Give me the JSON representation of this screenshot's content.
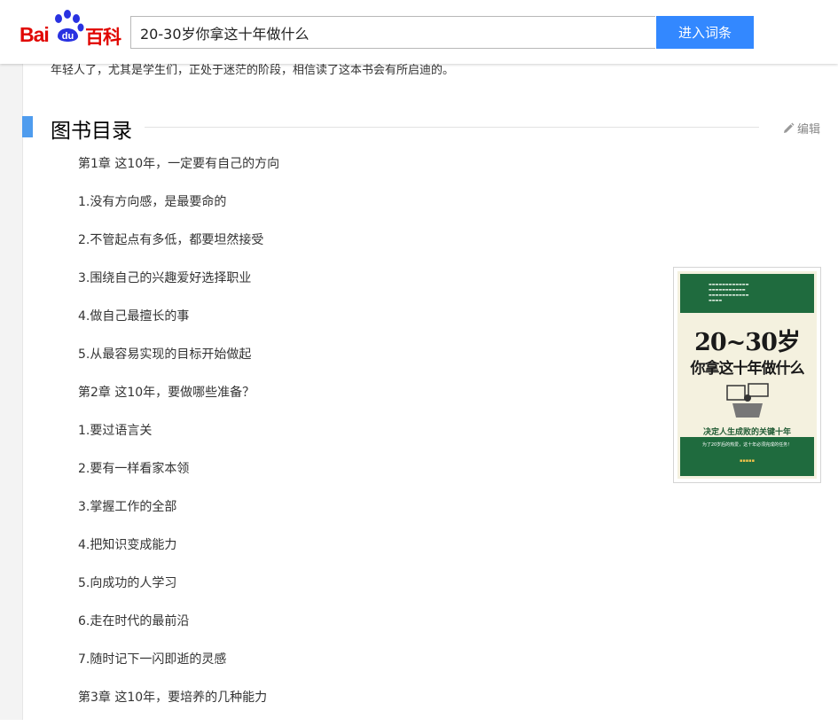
{
  "header": {
    "logo_text_left": "Bai",
    "logo_text_paw": "du",
    "logo_text_right": "百科",
    "search_value": "20-30岁你拿这十年做什么",
    "search_button_label": "进入词条"
  },
  "article": {
    "intro_fragment": "年轻人了，尤其是学生们，正处于迷茫的阶段，相信读了这本书会有所启迪的。",
    "section_title": "图书目录",
    "edit_label": "编辑",
    "toc_items": [
      "第1章 这10年，一定要有自己的方向",
      "1.没有方向感，是最要命的",
      "2.不管起点有多低，都要坦然接受",
      "3.围绕自己的兴趣爱好选择职业",
      "4.做自己最擅长的事",
      "5.从最容易实现的目标开始做起",
      "第2章 这10年，要做哪些准备？",
      "1.要过语言关",
      "2.要有一样看家本领",
      "3.掌握工作的全部",
      "4.把知识变成能力",
      "5.向成功的人学习",
      "6.走在时代的最前沿",
      "7.随时记下一闪即逝的灵感",
      "第3章 这10年，要培养的几种能力"
    ]
  },
  "book_cover": {
    "title_line_1": "20~30岁",
    "title_line_2": "你拿这十年做什么",
    "subtitle": "决定人生成败的关键十年",
    "bottom_text": "为了20岁后的热爱，这十年必须完成的任务！"
  },
  "colors": {
    "brand_red": "#e10601",
    "brand_blue": "#2932e1",
    "button_blue": "#3388ff",
    "section_accent": "#4f9cee",
    "cover_green": "#1f6b3e"
  },
  "icons": {
    "logo_paw": "paw-icon",
    "edit": "pencil-icon"
  }
}
